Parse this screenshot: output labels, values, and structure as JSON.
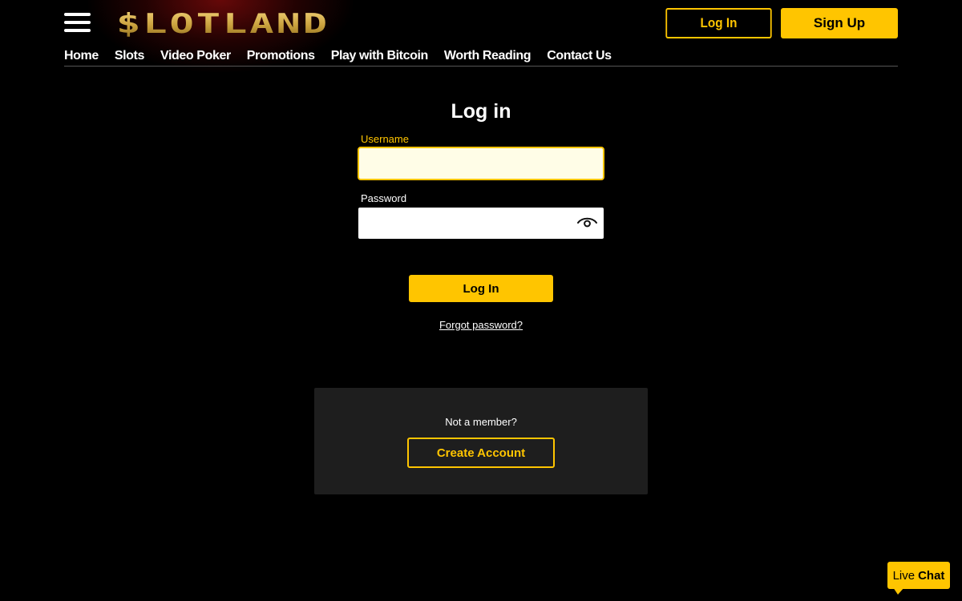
{
  "header": {
    "logo_text": "$LOTLAND",
    "login_label": "Log In",
    "signup_label": "Sign Up"
  },
  "nav": {
    "items": [
      "Home",
      "Slots",
      "Video Poker",
      "Promotions",
      "Play with Bitcoin",
      "Worth Reading",
      "Contact Us"
    ]
  },
  "form": {
    "title": "Log in",
    "username_label": "Username",
    "username_value": "",
    "password_label": "Password",
    "password_value": "",
    "submit_label": "Log In",
    "forgot_label": "Forgot password?"
  },
  "signup_panel": {
    "prompt": "Not a member?",
    "button_label": "Create Account"
  },
  "live_chat": {
    "label_live": "Live",
    "label_chat": "Chat"
  },
  "icons": {
    "menu": "hamburger-menu-icon",
    "password_toggle": "eye-icon"
  },
  "colors": {
    "accent": "#ffc500",
    "background": "#000000",
    "panel": "#1e1e1e"
  }
}
